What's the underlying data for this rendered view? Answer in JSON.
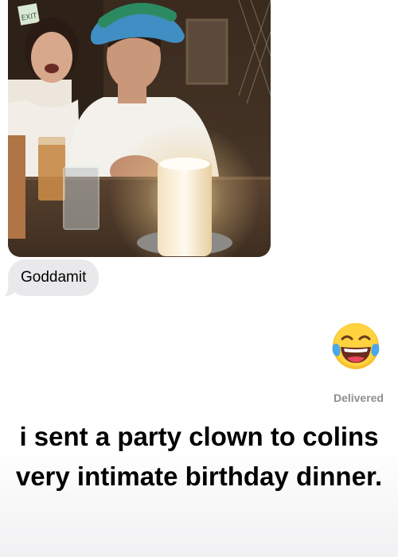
{
  "conversation": {
    "photo": {
      "kind": "photo attachment",
      "exit_sign_text": "EXIT"
    },
    "received_message": "Goddamit",
    "sent_reaction_icon": "tears-of-joy-emoji",
    "status": "Delivered"
  },
  "story_caption": "i sent a party clown to colins very intimate birthday dinner.",
  "colors": {
    "received_bubble": "#e9e9eb",
    "status_text": "#8e8e93",
    "caption_text": "#000000"
  }
}
